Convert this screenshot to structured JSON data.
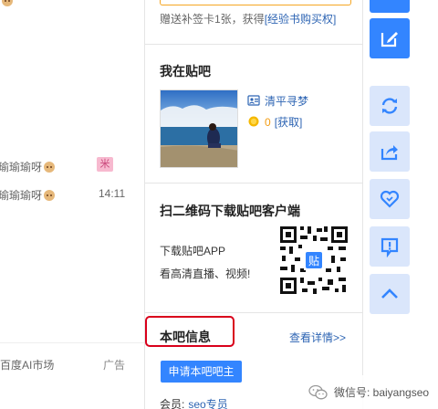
{
  "feed": {
    "rows": [
      {
        "text": "瑜瑜瑜呀"
      },
      {
        "text": "瑜瑜瑜呀"
      }
    ],
    "badge": "米",
    "time": "14:11",
    "ad_left": "百度AI市场",
    "ad_right": "广告"
  },
  "panel": {
    "gift_text": "赠送补签卡1张，获得",
    "gift_link": "[经验书购买权]",
    "my_tieba_title": "我在贴吧",
    "user_name": "清平寻梦",
    "coin_count": "0",
    "coin_link": "[获取]",
    "qr_title": "扫二维码下载贴吧客户端",
    "qr_line1": "下载贴吧APP",
    "qr_line2": "看高清直播、视频!",
    "qr_center": "贴",
    "info_title": "本吧信息",
    "detail_link": "查看详情>>",
    "apply_button": "申请本吧吧主",
    "member_label": "会员:",
    "member_value": "seo专员"
  },
  "toolbar": {
    "items": [
      {
        "icon": "top-partial-icon"
      },
      {
        "icon": "edit-icon"
      },
      {
        "icon": "refresh-icon"
      },
      {
        "icon": "share-icon"
      },
      {
        "icon": "favorite-heart-icon"
      },
      {
        "icon": "report-icon"
      },
      {
        "icon": "back-to-top-icon"
      }
    ]
  },
  "watermark": {
    "text": "微信号: baiyangseo"
  },
  "colors": {
    "link": "#2d64b3",
    "button_blue": "#3385ff",
    "tool_light": "#dae6fb",
    "highlight_red": "#d9001b"
  }
}
